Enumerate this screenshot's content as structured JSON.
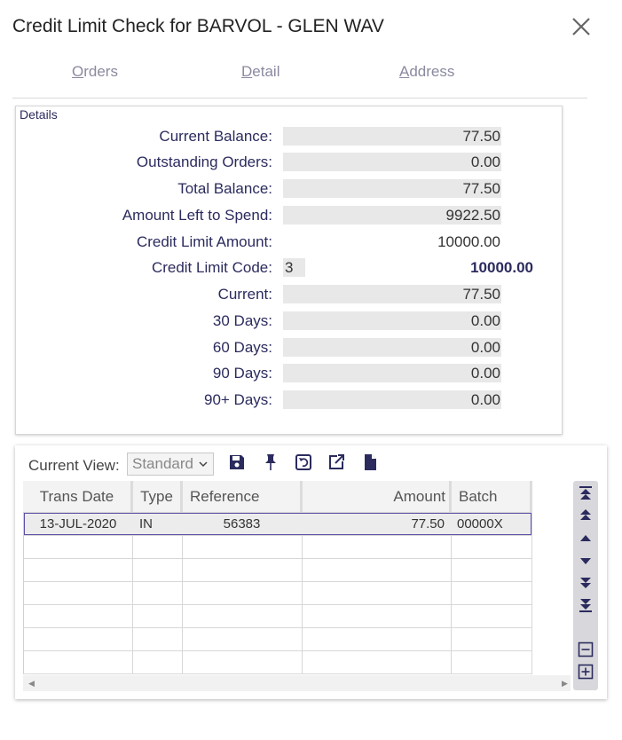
{
  "dialog": {
    "title": "Credit Limit Check for BARVOL - GLEN WAV",
    "close_icon": "close-icon"
  },
  "tabs": [
    {
      "label": "Orders",
      "accesskey": "O"
    },
    {
      "label": "Detail",
      "accesskey": "D"
    },
    {
      "label": "Address",
      "accesskey": "A"
    }
  ],
  "details": {
    "legend": "Details",
    "fields": {
      "current_balance": {
        "label": "Current Balance:",
        "value": "77.50"
      },
      "outstanding_orders": {
        "label": "Outstanding Orders:",
        "value": "0.00"
      },
      "total_balance": {
        "label": "Total Balance:",
        "value": "77.50"
      },
      "amount_left": {
        "label": "Amount Left to Spend:",
        "value": "9922.50"
      },
      "credit_limit_amount": {
        "label": "Credit Limit Amount:",
        "value": "10000.00"
      },
      "credit_limit_code": {
        "label": "Credit Limit Code:",
        "code": "3",
        "value": "10000.00"
      },
      "current": {
        "label": "Current:",
        "value": "77.50"
      },
      "days30": {
        "label": "30 Days:",
        "value": "0.00"
      },
      "days60": {
        "label": "60 Days:",
        "value": "0.00"
      },
      "days90": {
        "label": "90 Days:",
        "value": "0.00"
      },
      "days90plus": {
        "label": "90+ Days:",
        "value": "0.00"
      }
    }
  },
  "grid": {
    "current_view_label": "Current View:",
    "current_view_value": "Standard",
    "toolbar_icons": [
      "save-icon",
      "pin-icon",
      "reset-view-icon",
      "export-icon",
      "document-icon"
    ],
    "columns": [
      "Trans Date",
      "Type",
      "Reference",
      "Amount",
      "Batch"
    ],
    "rows": [
      {
        "trans_date": "13-JUL-2020",
        "type": "IN",
        "reference": "56383",
        "amount": "77.50",
        "batch": "00000X"
      }
    ],
    "nav_icons": [
      "first-page-icon",
      "page-up-icon",
      "row-up-icon",
      "row-down-icon",
      "page-down-icon",
      "last-page-icon",
      "remove-row-icon",
      "add-row-icon"
    ]
  }
}
